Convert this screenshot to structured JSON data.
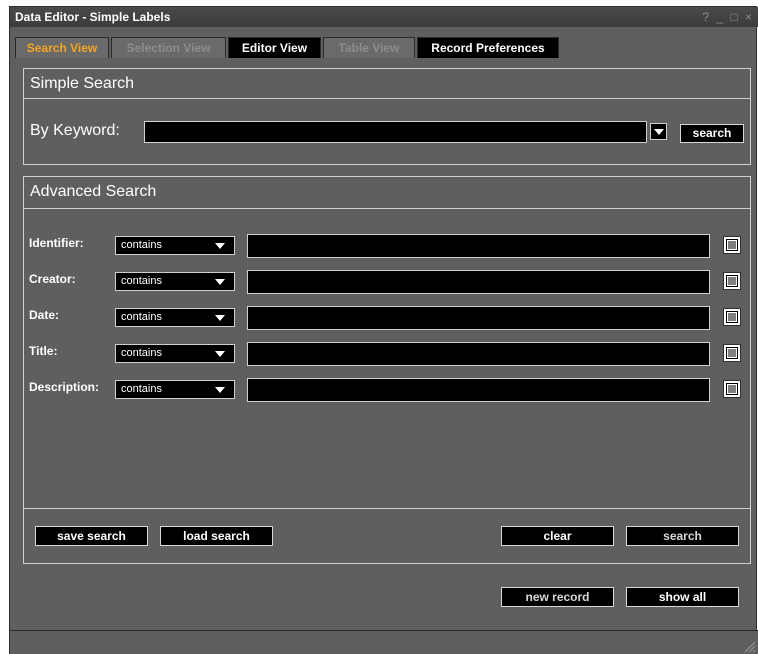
{
  "window": {
    "title": "Data Editor - Simple Labels",
    "controls": {
      "help": "?",
      "minimize": "_",
      "maximize": "□",
      "close": "×"
    }
  },
  "tabs": [
    {
      "label": "Search View",
      "state": "active"
    },
    {
      "label": "Selection View",
      "state": "disabled"
    },
    {
      "label": "Editor View",
      "state": "normal"
    },
    {
      "label": "Table View",
      "state": "disabled"
    },
    {
      "label": "Record Preferences",
      "state": "normal"
    }
  ],
  "simple_search": {
    "title": "Simple Search",
    "keyword_label": "By Keyword:",
    "keyword_value": "",
    "search_button": "search"
  },
  "advanced_search": {
    "title": "Advanced Search",
    "rows": [
      {
        "label": "Identifier:",
        "operator": "contains",
        "value": ""
      },
      {
        "label": "Creator:",
        "operator": "contains",
        "value": ""
      },
      {
        "label": "Date:",
        "operator": "contains",
        "value": ""
      },
      {
        "label": "Title:",
        "operator": "contains",
        "value": ""
      },
      {
        "label": "Description:",
        "operator": "contains",
        "value": ""
      }
    ],
    "buttons": {
      "save_search": "save search",
      "load_search": "load search",
      "clear": "clear",
      "search": "search"
    }
  },
  "footer": {
    "new_record": "new record",
    "show_all": "show all"
  },
  "colors": {
    "background": "#5f5f5f",
    "active_tab": "#f5a623",
    "field": "#000000",
    "border": "#d0d0d0"
  }
}
